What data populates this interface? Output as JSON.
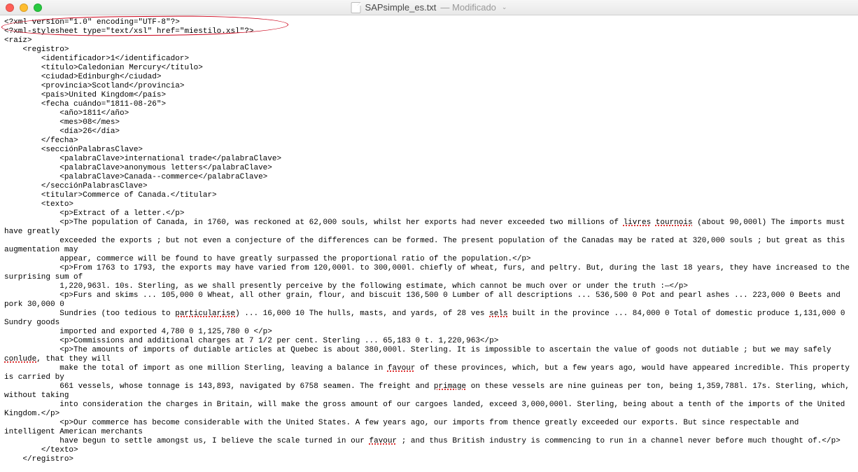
{
  "window": {
    "filename": "SAPsimple_es.txt",
    "status_suffix": "— Modificado",
    "dropdown_glyph": "⌄"
  },
  "lines": [
    {
      "t": "<?xml version=\"1.0\" encoding=\"UTF-8\"?>"
    },
    {
      "t": "<?xml-stylesheet type=\"text/xsl\" href=\"miestilo.xsl\"?>"
    },
    {
      "t": "<raíz>"
    },
    {
      "t": "    <registro>"
    },
    {
      "t": "        <identificador>1</identificador>"
    },
    {
      "t": "        <título>Caledonian Mercury</título>"
    },
    {
      "t": "        <ciudad>Edinburgh</ciudad>"
    },
    {
      "t": "        <provincia>Scotland</provincia>"
    },
    {
      "t": "        <país>United Kingdom</país>"
    },
    {
      "t": "        <fecha cuándo=\"1811-08-26\">"
    },
    {
      "t": "            <año>1811</año>"
    },
    {
      "t": "            <mes>08</mes>"
    },
    {
      "t": "            <día>26</día>"
    },
    {
      "t": "        </fecha>"
    },
    {
      "t": "        <secciónPalabrasClave>"
    },
    {
      "t": "            <palabraClave>international trade</palabraClave>"
    },
    {
      "t": "            <palabraClave>anonymous letters</palabraClave>"
    },
    {
      "t": "            <palabraClave>Canada--commerce</palabraClave>"
    },
    {
      "t": "        </secciónPalabrasClave>"
    },
    {
      "t": "        <titular>Commerce of Canada.</titular>"
    },
    {
      "t": "        <texto>"
    },
    {
      "t": "            <p>Extract of a letter.</p>"
    },
    {
      "t": "            <p>The population of Canada, in 1760, was reckoned at 62,000 souls, whilst her exports had never exceeded two millions of ",
      "spell": [
        "livres",
        "tournois"
      ],
      "after": " (about 90,000l) The imports must have greatly"
    },
    {
      "t": "            exceeded the exports ; but not even a conjecture of the differences can be formed. The present population of the Canadas may be rated at 320,000 souls ; but great as this augmentation may"
    },
    {
      "t": "            appear, commerce will be found to have greatly surpassed the proportional ratio of the population.</p>"
    },
    {
      "t": "            <p>From 1763 to 1793, the exports may have varied from 120,000l. to 300,000l. chiefly of wheat, furs, and peltry. But, during the last 18 years, they have increased to the surprising sum of"
    },
    {
      "t": "            1,220,963l. 10s. Sterling, as we shall presently perceive by the following estimate, which cannot be much over or under the truth :—</p>"
    },
    {
      "t": "            <p>Furs and skims ... 105,000 0 Wheat, all other grain, flour, and biscuit 136,500 0 Lumber of all descriptions ... 536,500 0 Pot and pearl ashes ... 223,000 0 Beets and pork 30,000 0"
    },
    {
      "t": "            Sundries (too tedious to ",
      "spell": [
        "particularise"
      ],
      "after": ") ... 16,000 10 The hulls, masts, and yards, of 28 ves ",
      "spell2": [
        "sels"
      ],
      "after2": " built in the province ... 84,000 0 Total of domestic produce 1,131,000 0 Sundry goods"
    },
    {
      "t": "            imported and exported 4,780 0 1,125,780 0 </p>"
    },
    {
      "t": "            <p>Commissions and additional charges at 7 1/2 per cent. Sterling ... 65,183 0 t. 1,220,963</p>"
    },
    {
      "t": "            <p>The amounts of imports of dutiable articles at Quebec is about 380,000l. Sterling. It is impossible to ascertain the value of goods not dutiable ; but we may safely ",
      "spell": [
        "conlude"
      ],
      "after": ", that they will"
    },
    {
      "t": "            make the total of import as one million Sterling, leaving a balance in ",
      "spell": [
        "favour"
      ],
      "after": " of these provinces, which, but a few years ago, would have appeared incredible. This property is carried by"
    },
    {
      "t": "            661 vessels, whose tonnage is 143,893, navigated by 6758 seamen. The freight and ",
      "spell": [
        "primage"
      ],
      "after": " on these vessels are nine guineas per ton, being 1,359,788l. 17s. Sterling, which, without taking"
    },
    {
      "t": "            into consideration the charges in Britain, will make the gross amount of our cargoes landed, exceed 3,000,000l. Sterling, being about a tenth of the imports of the United Kingdom.</p>"
    },
    {
      "t": "            <p>Our commerce has become considerable with the United States. A few years ago, our imports from thence greatly exceeded our exports. But since respectable and intelligent American merchants"
    },
    {
      "t": "            have begun to settle amongst us, I believe the scale turned in our ",
      "spell": [
        "favour"
      ],
      "after": " ; and thus British industry is commencing to run in a channel never before much thought of.</p>"
    },
    {
      "t": "        </texto>"
    },
    {
      "t": "    </registro>"
    }
  ]
}
